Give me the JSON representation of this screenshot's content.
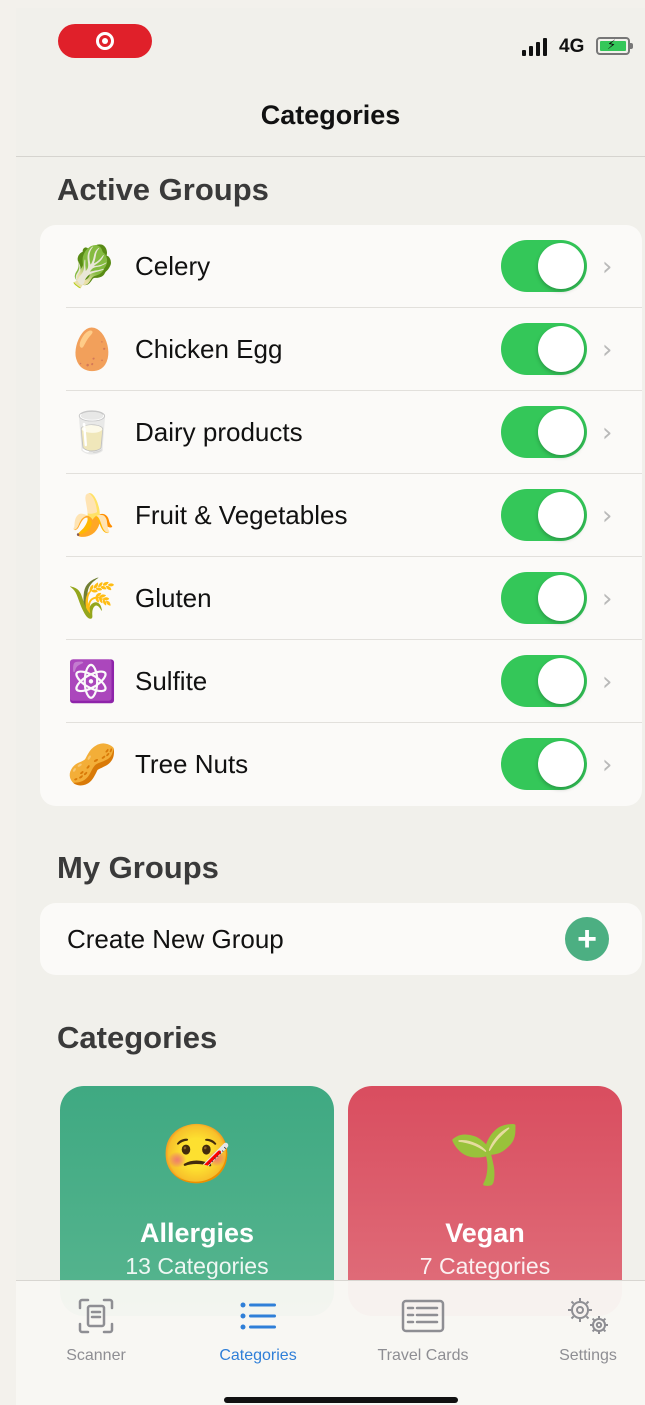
{
  "status_bar": {
    "network": "4G",
    "colors": {
      "record": "#e0202a",
      "battery": "#34c759"
    }
  },
  "nav": {
    "title": "Categories"
  },
  "active_groups": {
    "header": "Active Groups",
    "items": [
      {
        "emoji": "🥬",
        "icon": "celery-icon",
        "label": "Celery",
        "enabled": true
      },
      {
        "emoji": "🥚",
        "icon": "egg-icon",
        "label": "Chicken Egg",
        "enabled": true
      },
      {
        "emoji": "🥛",
        "icon": "milk-glass-icon",
        "label": "Dairy products",
        "enabled": true
      },
      {
        "emoji": "🍌",
        "icon": "banana-icon",
        "label": "Fruit & Vegetables",
        "enabled": true
      },
      {
        "emoji": "🌾",
        "icon": "wheat-icon",
        "label": "Gluten",
        "enabled": true
      },
      {
        "emoji": "⚛️",
        "icon": "atom-icon",
        "label": "Sulfite",
        "enabled": true
      },
      {
        "emoji": "🥜",
        "icon": "peanut-icon",
        "label": "Tree Nuts",
        "enabled": true
      }
    ]
  },
  "my_groups": {
    "header": "My Groups",
    "create_label": "Create New Group"
  },
  "categories": {
    "header": "Categories",
    "tiles": [
      {
        "emoji": "🤒",
        "icon": "sick-face-icon",
        "name": "Allergies",
        "count": "13 Categories",
        "color": "#4cae88"
      },
      {
        "emoji": "🌱",
        "icon": "seedling-icon",
        "name": "Vegan",
        "count": "7 Categories",
        "color": "#dc5d6c"
      }
    ]
  },
  "tab_bar": {
    "active_color": "#2f7fd8",
    "tabs": [
      {
        "label": "Scanner",
        "icon": "scanner-icon",
        "active": false
      },
      {
        "label": "Categories",
        "icon": "list-icon",
        "active": true
      },
      {
        "label": "Travel Cards",
        "icon": "card-icon",
        "active": false
      },
      {
        "label": "Settings",
        "icon": "gears-icon",
        "active": false
      }
    ]
  }
}
